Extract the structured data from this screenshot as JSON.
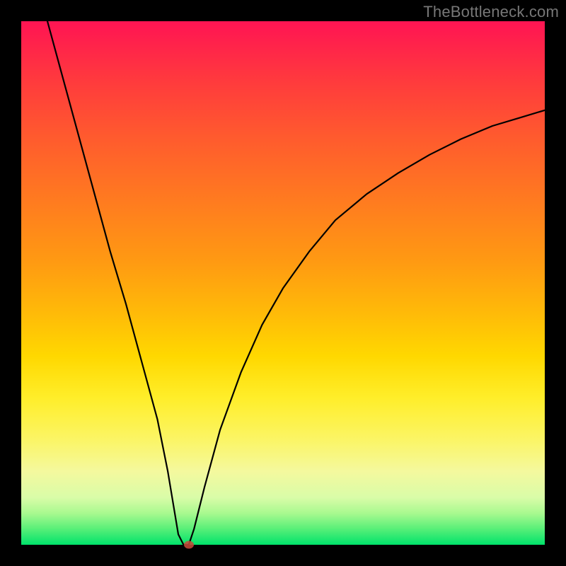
{
  "watermark": "TheBottleneck.com",
  "chart_data": {
    "type": "line",
    "title": "",
    "xlabel": "",
    "ylabel": "",
    "xlim": [
      0,
      100
    ],
    "ylim": [
      0,
      100
    ],
    "grid": false,
    "legend": false,
    "background_gradient": {
      "top": "#ff1453",
      "bottom": "#00e36b",
      "stops": [
        {
          "pos": 0.0,
          "color": "#ff1453"
        },
        {
          "pos": 0.12,
          "color": "#ff3c3c"
        },
        {
          "pos": 0.22,
          "color": "#ff5a2e"
        },
        {
          "pos": 0.34,
          "color": "#ff7a20"
        },
        {
          "pos": 0.46,
          "color": "#ff9a12"
        },
        {
          "pos": 0.56,
          "color": "#ffbb08"
        },
        {
          "pos": 0.64,
          "color": "#ffd800"
        },
        {
          "pos": 0.72,
          "color": "#ffee2a"
        },
        {
          "pos": 0.8,
          "color": "#fbf566"
        },
        {
          "pos": 0.86,
          "color": "#f4f99e"
        },
        {
          "pos": 0.91,
          "color": "#d9fca8"
        },
        {
          "pos": 0.94,
          "color": "#a8f98f"
        },
        {
          "pos": 0.97,
          "color": "#57ef78"
        },
        {
          "pos": 1.0,
          "color": "#00e36b"
        }
      ]
    },
    "marker": {
      "x": 32,
      "y": 0,
      "color": "#c94a3b"
    },
    "series": [
      {
        "name": "curve",
        "color": "#000000",
        "x": [
          5,
          8,
          11,
          14,
          17,
          20,
          23,
          26,
          28,
          29,
          30,
          31,
          32,
          33,
          35,
          38,
          42,
          46,
          50,
          55,
          60,
          66,
          72,
          78,
          84,
          90,
          95,
          100
        ],
        "y": [
          100,
          89,
          78,
          67,
          56,
          46,
          35,
          24,
          14,
          8,
          2,
          0,
          0,
          3,
          11,
          22,
          33,
          42,
          49,
          56,
          62,
          67,
          71,
          74.5,
          77.5,
          80,
          81.5,
          83
        ]
      }
    ]
  }
}
